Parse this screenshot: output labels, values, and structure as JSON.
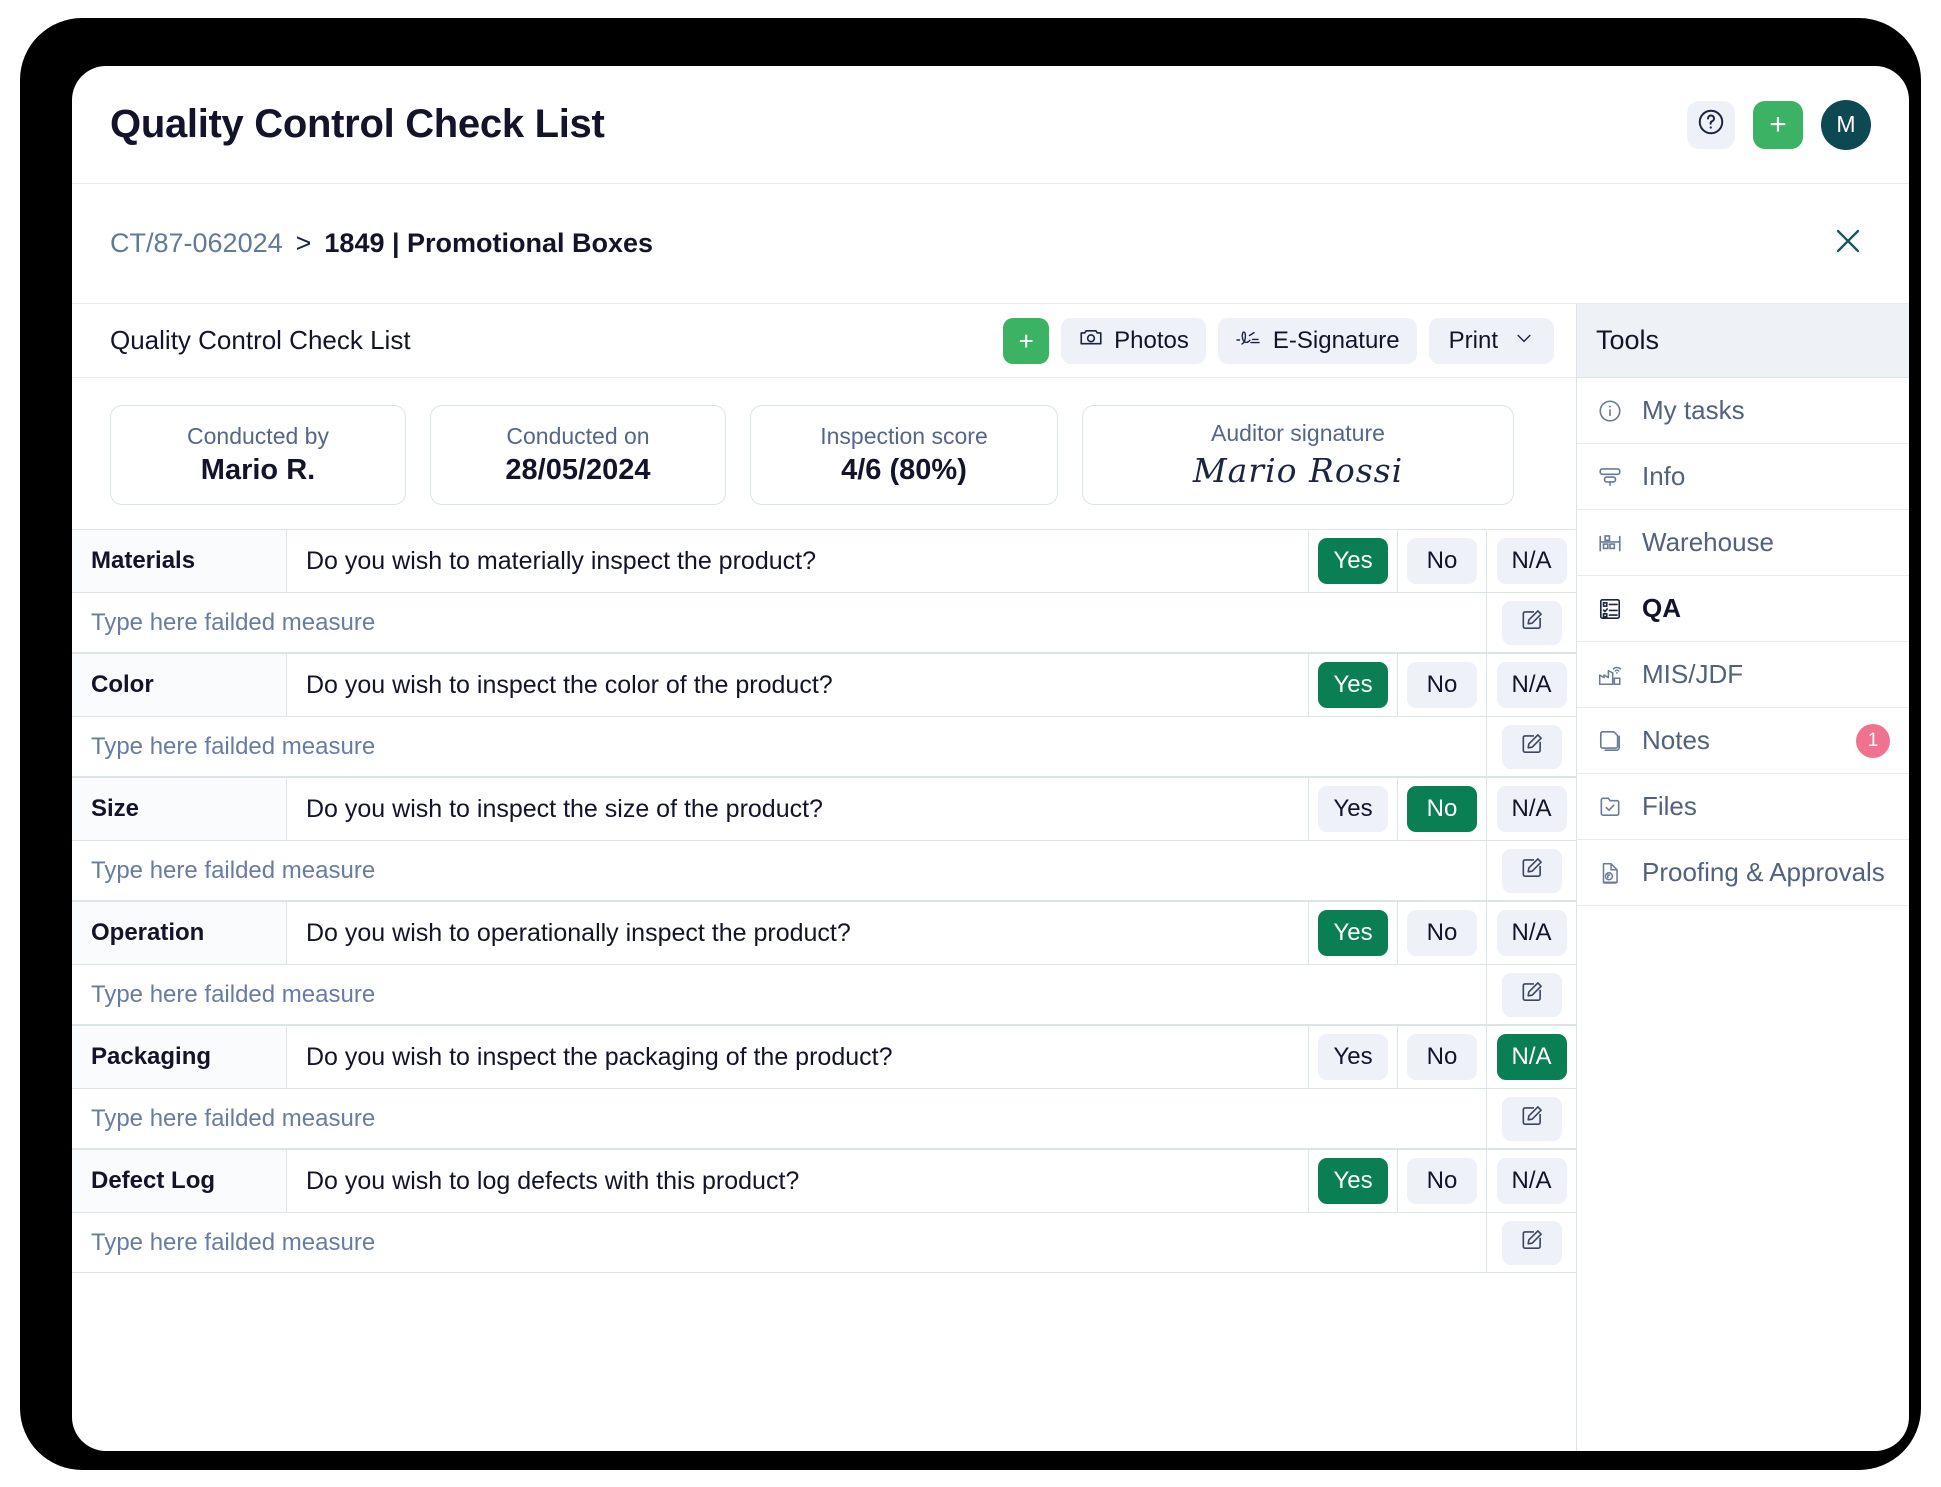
{
  "header": {
    "title": "Quality Control Check List",
    "help_icon": "question-circle-icon",
    "add_label": "+",
    "avatar_initial": "M"
  },
  "breadcrumb": {
    "link": "CT/87-062024",
    "separator": ">",
    "current": "1849 | Promotional Boxes",
    "close_icon": "close-icon"
  },
  "toolbar": {
    "section_title": "Quality Control Check List",
    "add_label": "+",
    "photos_label": "Photos",
    "esignature_label": "E-Signature",
    "print_label": "Print",
    "print_chevron": "chevron-down-icon"
  },
  "cards": [
    {
      "label": "Conducted by",
      "value": "Mario R.",
      "style": "text"
    },
    {
      "label": "Conducted on",
      "value": "28/05/2024",
      "style": "text"
    },
    {
      "label": "Inspection score",
      "value": "4/6 (80%)",
      "style": "text"
    },
    {
      "label": "Auditor signature",
      "value": "Mario Rossi",
      "style": "signature"
    }
  ],
  "options": [
    "Yes",
    "No",
    "N/A"
  ],
  "measure_placeholder": "Type here failded measure",
  "checklist": [
    {
      "category": "Materials",
      "question": "Do you wish to materially inspect the product?",
      "selected": "Yes"
    },
    {
      "category": "Color",
      "question": "Do you wish to inspect the color of the product?",
      "selected": "Yes"
    },
    {
      "category": "Size",
      "question": "Do you wish to inspect the size of the product?",
      "selected": "No"
    },
    {
      "category": "Operation",
      "question": "Do you wish to operationally inspect the product?",
      "selected": "Yes"
    },
    {
      "category": "Packaging",
      "question": "Do you wish to inspect the packaging of the product?",
      "selected": "N/A"
    },
    {
      "category": "Defect Log",
      "question": "Do you wish to log defects with this product?",
      "selected": "Yes"
    }
  ],
  "tools": {
    "title": "Tools",
    "items": [
      {
        "label": "My tasks",
        "icon": "info-circle-icon",
        "active": false,
        "badge": ""
      },
      {
        "label": "Info",
        "icon": "info-panel-icon",
        "active": false,
        "badge": ""
      },
      {
        "label": "Warehouse",
        "icon": "warehouse-icon",
        "active": false,
        "badge": ""
      },
      {
        "label": "QA",
        "icon": "checklist-icon",
        "active": true,
        "badge": ""
      },
      {
        "label": "MIS/JDF",
        "icon": "factory-wifi-icon",
        "active": false,
        "badge": ""
      },
      {
        "label": "Notes",
        "icon": "notes-icon",
        "active": false,
        "badge": "1"
      },
      {
        "label": "Files",
        "icon": "file-check-icon",
        "active": false,
        "badge": ""
      },
      {
        "label": "Proofing & Approvals",
        "icon": "proofing-icon",
        "active": false,
        "badge": ""
      }
    ]
  },
  "colors": {
    "accent_green": "#3cb264",
    "selected_green": "#0a7f54",
    "avatar_teal": "#0d4853",
    "badge_pink": "#ef7391",
    "ink": "#131429",
    "muted": "#52617f"
  }
}
